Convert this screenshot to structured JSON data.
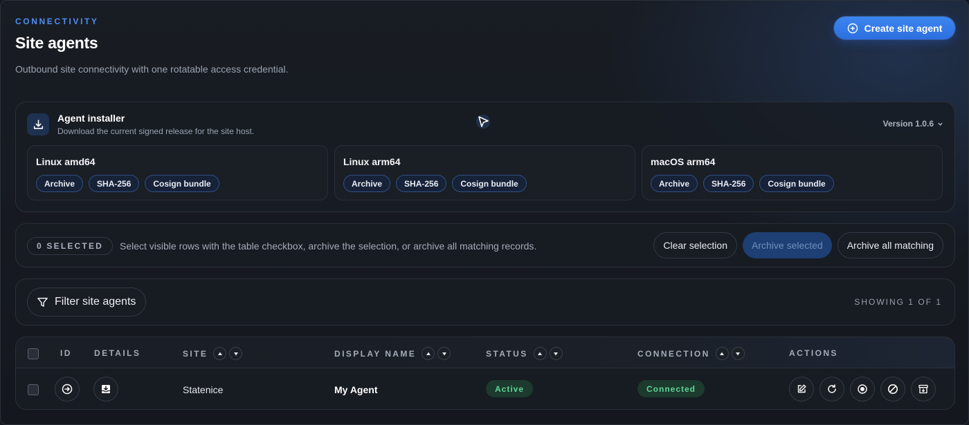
{
  "header": {
    "eyebrow": "CONNECTIVITY",
    "title": "Site agents",
    "subtitle": "Outbound site connectivity with one rotatable access credential.",
    "create_label": "Create site agent"
  },
  "installer": {
    "title": "Agent installer",
    "description": "Download the current signed release for the site host.",
    "version": "Version 1.0.6",
    "cards": [
      {
        "title": "Linux amd64",
        "links": [
          "Archive",
          "SHA-256",
          "Cosign bundle"
        ]
      },
      {
        "title": "Linux arm64",
        "links": [
          "Archive",
          "SHA-256",
          "Cosign bundle"
        ]
      },
      {
        "title": "macOS arm64",
        "links": [
          "Archive",
          "SHA-256",
          "Cosign bundle"
        ]
      }
    ]
  },
  "selection": {
    "count_label": "0 SELECTED",
    "help": "Select visible rows with the table checkbox, archive the selection, or archive all matching records.",
    "clear": "Clear selection",
    "archive_selected": "Archive selected",
    "archive_all": "Archive all matching"
  },
  "filter": {
    "label": "Filter site agents",
    "showing": "SHOWING 1 OF 1"
  },
  "table": {
    "columns": [
      "ID",
      "DETAILS",
      "SITE",
      "DISPLAY NAME",
      "STATUS",
      "CONNECTION",
      "ACTIONS"
    ],
    "rows": [
      {
        "site": "Statenice",
        "display_name": "My Agent",
        "status": "Active",
        "connection": "Connected"
      }
    ]
  },
  "colors": {
    "accent": "#3c86f0",
    "success": "#5fd49a",
    "background": "#15191f"
  }
}
